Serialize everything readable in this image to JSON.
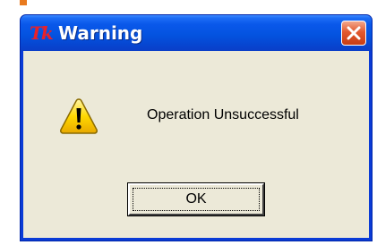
{
  "dialog": {
    "title": "Warning",
    "app_icon": "tk-icon",
    "app_icon_text": "Tk",
    "close_icon": "close-icon",
    "message": "Operation Unsuccessful",
    "message_icon": "warning-icon",
    "ok_label": "OK"
  },
  "colors": {
    "titlebar": "#0453e0",
    "client_background": "#ece9d8",
    "close_button": "#e2592f",
    "warning_yellow": "#ffd800"
  }
}
